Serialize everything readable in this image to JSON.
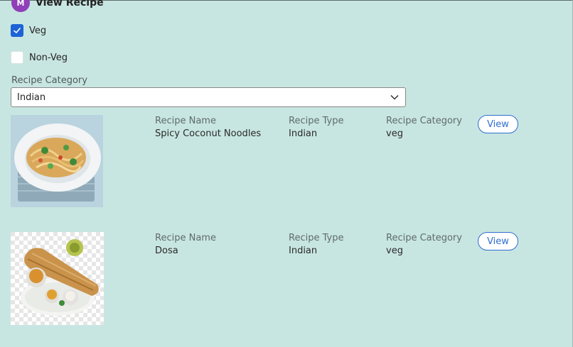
{
  "header": {
    "avatar_initial": "M",
    "title": "View Recipe"
  },
  "filters": {
    "veg": {
      "label": "Veg",
      "checked": true
    },
    "nonveg": {
      "label": "Non-Veg",
      "checked": false
    }
  },
  "category_select": {
    "label": "Recipe Category",
    "value": "Indian"
  },
  "recipes": [
    {
      "name_label": "Recipe Name",
      "name": "Spicy Coconut Noodles",
      "type_label": "Recipe Type",
      "type": "Indian",
      "category_label": "Recipe Category",
      "category": "veg",
      "view_label": "View"
    },
    {
      "name_label": "Recipe Name",
      "name": "Dosa",
      "type_label": "Recipe Type",
      "type": "Indian",
      "category_label": "Recipe Category",
      "category": "veg",
      "view_label": "View"
    }
  ],
  "colors": {
    "background": "#c8e6e1",
    "accent": "#1d63d6",
    "avatar": "#8f3fb8"
  }
}
